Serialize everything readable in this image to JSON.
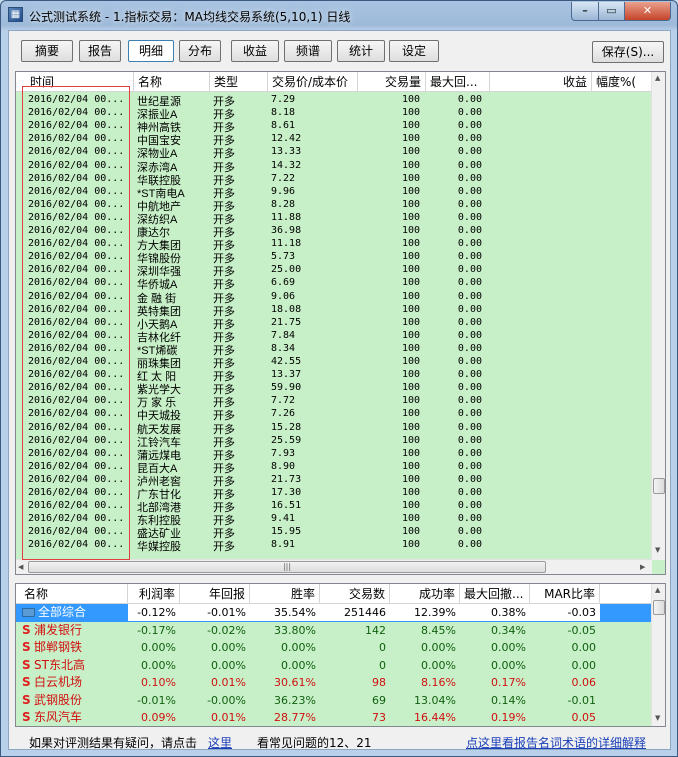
{
  "window": {
    "title": "公式测试系统 - 1.指标交易：MA均线交易系统(5,10,1) 日线",
    "min": "–",
    "max": "▭",
    "close": "✕"
  },
  "tabs": [
    "摘要",
    "报告",
    "明细",
    "分布",
    "收益",
    "频谱",
    "统计",
    "设定"
  ],
  "active_tab": "明细",
  "save_label": "保存(S)...",
  "grid": {
    "headers": [
      "时间",
      "名称",
      "类型",
      "交易价/成本价",
      "交易量",
      "最大回...",
      "收益",
      "幅度%("
    ],
    "rows": [
      [
        "2016/02/04 00...",
        "世纪星源",
        "开多",
        "7.29",
        "100",
        "0.00"
      ],
      [
        "2016/02/04 00...",
        "深振业A",
        "开多",
        "8.18",
        "100",
        "0.00"
      ],
      [
        "2016/02/04 00...",
        "神州高铁",
        "开多",
        "8.61",
        "100",
        "0.00"
      ],
      [
        "2016/02/04 00...",
        "中国宝安",
        "开多",
        "12.42",
        "100",
        "0.00"
      ],
      [
        "2016/02/04 00...",
        "深物业A",
        "开多",
        "13.33",
        "100",
        "0.00"
      ],
      [
        "2016/02/04 00...",
        "深赤湾A",
        "开多",
        "14.32",
        "100",
        "0.00"
      ],
      [
        "2016/02/04 00...",
        "华联控股",
        "开多",
        "7.22",
        "100",
        "0.00"
      ],
      [
        "2016/02/04 00...",
        "*ST南电A",
        "开多",
        "9.96",
        "100",
        "0.00"
      ],
      [
        "2016/02/04 00...",
        "中航地产",
        "开多",
        "8.28",
        "100",
        "0.00"
      ],
      [
        "2016/02/04 00...",
        "深纺织A",
        "开多",
        "11.88",
        "100",
        "0.00"
      ],
      [
        "2016/02/04 00...",
        "康达尔",
        "开多",
        "36.98",
        "100",
        "0.00"
      ],
      [
        "2016/02/04 00...",
        "方大集团",
        "开多",
        "11.18",
        "100",
        "0.00"
      ],
      [
        "2016/02/04 00...",
        "华锦股份",
        "开多",
        "5.73",
        "100",
        "0.00"
      ],
      [
        "2016/02/04 00...",
        "深圳华强",
        "开多",
        "25.00",
        "100",
        "0.00"
      ],
      [
        "2016/02/04 00...",
        "华侨城A",
        "开多",
        "6.69",
        "100",
        "0.00"
      ],
      [
        "2016/02/04 00...",
        "金 融 街",
        "开多",
        "9.06",
        "100",
        "0.00"
      ],
      [
        "2016/02/04 00...",
        "英特集团",
        "开多",
        "18.08",
        "100",
        "0.00"
      ],
      [
        "2016/02/04 00...",
        "小天鹅A",
        "开多",
        "21.75",
        "100",
        "0.00"
      ],
      [
        "2016/02/04 00...",
        "吉林化纤",
        "开多",
        "7.84",
        "100",
        "0.00"
      ],
      [
        "2016/02/04 00...",
        "*ST烯碳",
        "开多",
        "8.34",
        "100",
        "0.00"
      ],
      [
        "2016/02/04 00...",
        "丽珠集团",
        "开多",
        "42.55",
        "100",
        "0.00"
      ],
      [
        "2016/02/04 00...",
        "红 太 阳",
        "开多",
        "13.37",
        "100",
        "0.00"
      ],
      [
        "2016/02/04 00...",
        "紫光学大",
        "开多",
        "59.90",
        "100",
        "0.00"
      ],
      [
        "2016/02/04 00...",
        "万 家 乐",
        "开多",
        "7.72",
        "100",
        "0.00"
      ],
      [
        "2016/02/04 00...",
        "中天城投",
        "开多",
        "7.26",
        "100",
        "0.00"
      ],
      [
        "2016/02/04 00...",
        "航天发展",
        "开多",
        "15.28",
        "100",
        "0.00"
      ],
      [
        "2016/02/04 00...",
        "江铃汽车",
        "开多",
        "25.59",
        "100",
        "0.00"
      ],
      [
        "2016/02/04 00...",
        "蒲远煤电",
        "开多",
        "7.93",
        "100",
        "0.00"
      ],
      [
        "2016/02/04 00...",
        "昆百大A",
        "开多",
        "8.90",
        "100",
        "0.00"
      ],
      [
        "2016/02/04 00...",
        "泸州老窖",
        "开多",
        "21.73",
        "100",
        "0.00"
      ],
      [
        "2016/02/04 00...",
        "广东甘化",
        "开多",
        "17.30",
        "100",
        "0.00"
      ],
      [
        "2016/02/04 00...",
        "北部湾港",
        "开多",
        "16.51",
        "100",
        "0.00"
      ],
      [
        "2016/02/04 00...",
        "东利控股",
        "开多",
        "9.41",
        "100",
        "0.00"
      ],
      [
        "2016/02/04 00...",
        "盛达矿业",
        "开多",
        "15.95",
        "100",
        "0.00"
      ],
      [
        "2016/02/04 00...",
        "华媒控股",
        "开多",
        "8.91",
        "100",
        "0.00"
      ]
    ],
    "hscroll_grip": "|||"
  },
  "summary": {
    "headers": [
      "名称",
      "利润率",
      "年回报",
      "胜率",
      "交易数",
      "成功率",
      "最大回撤...",
      "MAR比率"
    ],
    "rows": [
      {
        "name": "全部综合",
        "icon": "folder-icon",
        "vals": [
          "-0.12%",
          "-0.01%",
          "35.54%",
          "251446",
          "12.39%",
          "0.38%",
          "-0.03"
        ],
        "selected": true
      },
      {
        "name": "浦发银行",
        "icon": "S",
        "vals": [
          "-0.17%",
          "-0.02%",
          "33.80%",
          "142",
          "8.45%",
          "0.34%",
          "-0.05"
        ]
      },
      {
        "name": "邯郸钢铁",
        "icon": "S",
        "vals": [
          "0.00%",
          "0.00%",
          "0.00%",
          "0",
          "0.00%",
          "0.00%",
          "0.00"
        ]
      },
      {
        "name": "ST东北高",
        "icon": "S",
        "vals": [
          "0.00%",
          "0.00%",
          "0.00%",
          "0",
          "0.00%",
          "0.00%",
          "0.00"
        ]
      },
      {
        "name": "白云机场",
        "icon": "S",
        "vals": [
          "0.10%",
          "0.01%",
          "30.61%",
          "98",
          "8.16%",
          "0.17%",
          "0.06"
        ],
        "red": true
      },
      {
        "name": "武钢股份",
        "icon": "S",
        "vals": [
          "-0.01%",
          "-0.00%",
          "36.23%",
          "69",
          "13.04%",
          "0.14%",
          "-0.01"
        ]
      },
      {
        "name": "东风汽车",
        "icon": "S",
        "vals": [
          "0.09%",
          "0.01%",
          "28.77%",
          "73",
          "16.44%",
          "0.19%",
          "0.05"
        ],
        "red": true
      }
    ]
  },
  "footer": {
    "text1": "如果对评测结果有疑问，请点击",
    "link1": "这里",
    "text2": "看常见问题的12、21",
    "link2": "点这里看报告名词术语的详细解释"
  }
}
